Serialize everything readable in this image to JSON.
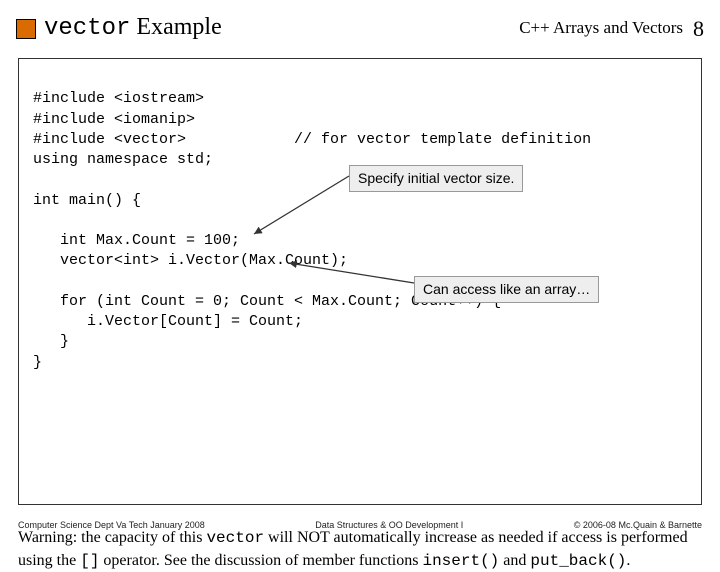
{
  "header": {
    "title_code": "vector",
    "title_rest": " Example",
    "subtitle": "C++ Arrays and Vectors",
    "pagenum": "8"
  },
  "code": {
    "line1": "#include <iostream>",
    "line2": "#include <iomanip>",
    "line3": "#include <vector>            // for vector template definition",
    "line4": "using namespace std;",
    "line5": "",
    "line6": "int main() {",
    "line7": "",
    "line8": "   int Max.Count = 100;",
    "line9": "   vector<int> i.Vector(Max.Count);",
    "line10": "",
    "line11": "   for (int Count = 0; Count < Max.Count; Count++) {",
    "line12": "      i.Vector[Count] = Count;",
    "line13": "   }",
    "line14": "}"
  },
  "callouts": {
    "c1": "Specify initial vector size.",
    "c2": "Can access like an array…"
  },
  "warning": {
    "p1a": "Warning: the capacity of this ",
    "p1b": "vector",
    "p1c": " will NOT automatically increase as needed if access is performed using the ",
    "p1d": "[]",
    "p1e": " operator.  See the discussion of member functions ",
    "p1f": "insert()",
    "p1g": " and ",
    "p1h": "put_back()",
    "p1i": "."
  },
  "footer": {
    "left": "Computer Science Dept Va Tech January 2008",
    "center": "Data Structures & OO Development I",
    "right": "© 2006-08 Mc.Quain & Barnette"
  }
}
